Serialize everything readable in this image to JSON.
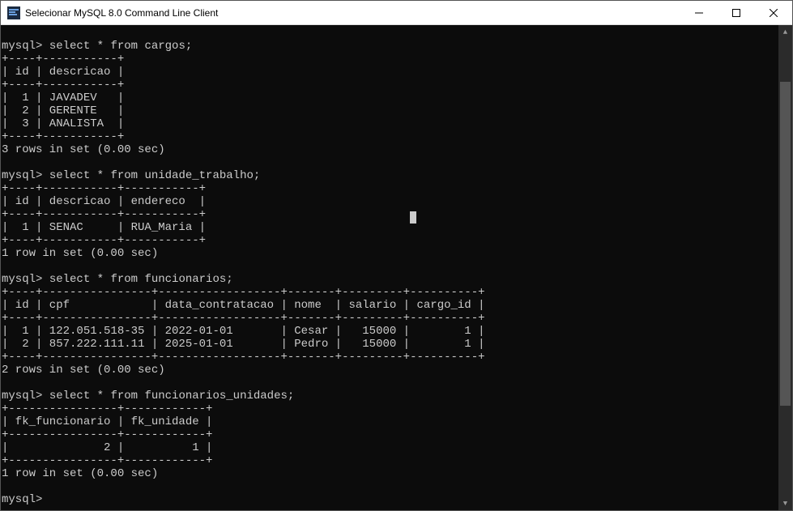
{
  "window": {
    "title": "Selecionar MySQL 8.0 Command Line Client"
  },
  "prompt": "mysql>",
  "queries": {
    "q1": "select * from cargos;",
    "q2": "select * from unidade_trabalho;",
    "q3": "select * from funcionarios;",
    "q4": "select * from funcionarios_unidades;"
  },
  "tables": {
    "cargos": {
      "sep": "+----+-----------+",
      "head": "| id | descricao |",
      "rows": [
        "|  1 | JAVADEV   |",
        "|  2 | GERENTE   |",
        "|  3 | ANALISTA  |"
      ],
      "status": "3 rows in set (0.00 sec)"
    },
    "unidade_trabalho": {
      "sep": "+----+-----------+-----------+",
      "head": "| id | descricao | endereco  |",
      "rows": [
        "|  1 | SENAC     | RUA_Maria |"
      ],
      "status": "1 row in set (0.00 sec)"
    },
    "funcionarios": {
      "sep": "+----+----------------+------------------+-------+---------+----------+",
      "head": "| id | cpf            | data_contratacao | nome  | salario | cargo_id |",
      "rows": [
        "|  1 | 122.051.518-35 | 2022-01-01       | Cesar |   15000 |        1 |",
        "|  2 | 857.222.111.11 | 2025-01-01       | Pedro |   15000 |        1 |"
      ],
      "status": "2 rows in set (0.00 sec)"
    },
    "funcionarios_unidades": {
      "sep": "+----------------+------------+",
      "head": "| fk_funcionario | fk_unidade |",
      "rows": [
        "|              2 |          1 |"
      ],
      "status": "1 row in set (0.00 sec)"
    }
  },
  "chart_data": {
    "type": "table",
    "tables": [
      {
        "name": "cargos",
        "columns": [
          "id",
          "descricao"
        ],
        "rows": [
          [
            1,
            "JAVADEV"
          ],
          [
            2,
            "GERENTE"
          ],
          [
            3,
            "ANALISTA"
          ]
        ]
      },
      {
        "name": "unidade_trabalho",
        "columns": [
          "id",
          "descricao",
          "endereco"
        ],
        "rows": [
          [
            1,
            "SENAC",
            "RUA_Maria"
          ]
        ]
      },
      {
        "name": "funcionarios",
        "columns": [
          "id",
          "cpf",
          "data_contratacao",
          "nome",
          "salario",
          "cargo_id"
        ],
        "rows": [
          [
            1,
            "122.051.518-35",
            "2022-01-01",
            "Cesar",
            15000,
            1
          ],
          [
            2,
            "857.222.111.11",
            "2025-01-01",
            "Pedro",
            15000,
            1
          ]
        ]
      },
      {
        "name": "funcionarios_unidades",
        "columns": [
          "fk_funcionario",
          "fk_unidade"
        ],
        "rows": [
          [
            2,
            1
          ]
        ]
      }
    ]
  }
}
